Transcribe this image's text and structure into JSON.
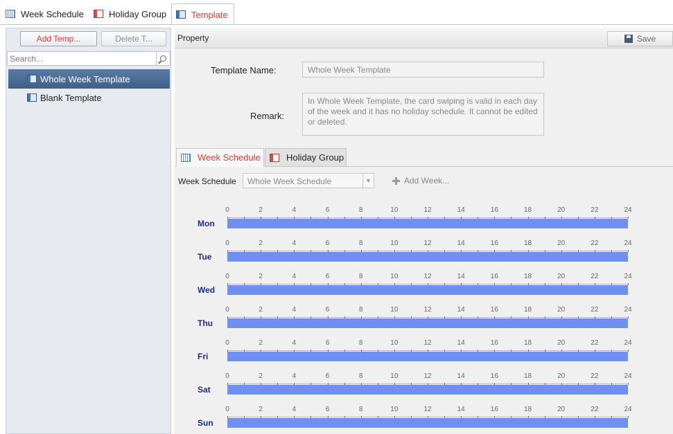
{
  "top_tabs": [
    {
      "label": "Week Schedule",
      "icon": "calendar-grid-icon",
      "active": false
    },
    {
      "label": "Holiday Group",
      "icon": "holiday-icon",
      "active": false
    },
    {
      "label": "Template",
      "icon": "template-icon",
      "active": true
    }
  ],
  "left": {
    "add_label": "Add Temp...",
    "delete_label": "Delete T...",
    "search_placeholder": "Search...",
    "items": [
      {
        "label": "Whole Week Template",
        "selected": true
      },
      {
        "label": "Blank Template",
        "selected": false
      }
    ]
  },
  "property": {
    "title": "Property",
    "save_label": "Save",
    "name_label": "Template Name:",
    "name_value": "Whole Week Template",
    "remark_label": "Remark:",
    "remark_value": "In Whole Week Template, the card swiping is valid in each day of the week and it has no holiday schedule. It cannot be edited or deleted."
  },
  "sub_tabs": [
    {
      "label": "Week Schedule",
      "active": true
    },
    {
      "label": "Holiday Group",
      "active": false
    }
  ],
  "schedule": {
    "label": "Week Schedule",
    "selected": "Whole Week Schedule",
    "add_week_label": "Add Week...",
    "hour_ticks": [
      "0",
      "2",
      "4",
      "6",
      "8",
      "10",
      "12",
      "14",
      "16",
      "18",
      "20",
      "22",
      "24"
    ],
    "days": [
      "Mon",
      "Tue",
      "Wed",
      "Thu",
      "Fri",
      "Sat",
      "Sun"
    ],
    "bar_color": "#6f8ff2",
    "coverage_start_hour": 0,
    "coverage_end_hour": 24
  },
  "colors": {
    "accent": "#d83a3a",
    "selection": "#4a6b93"
  }
}
